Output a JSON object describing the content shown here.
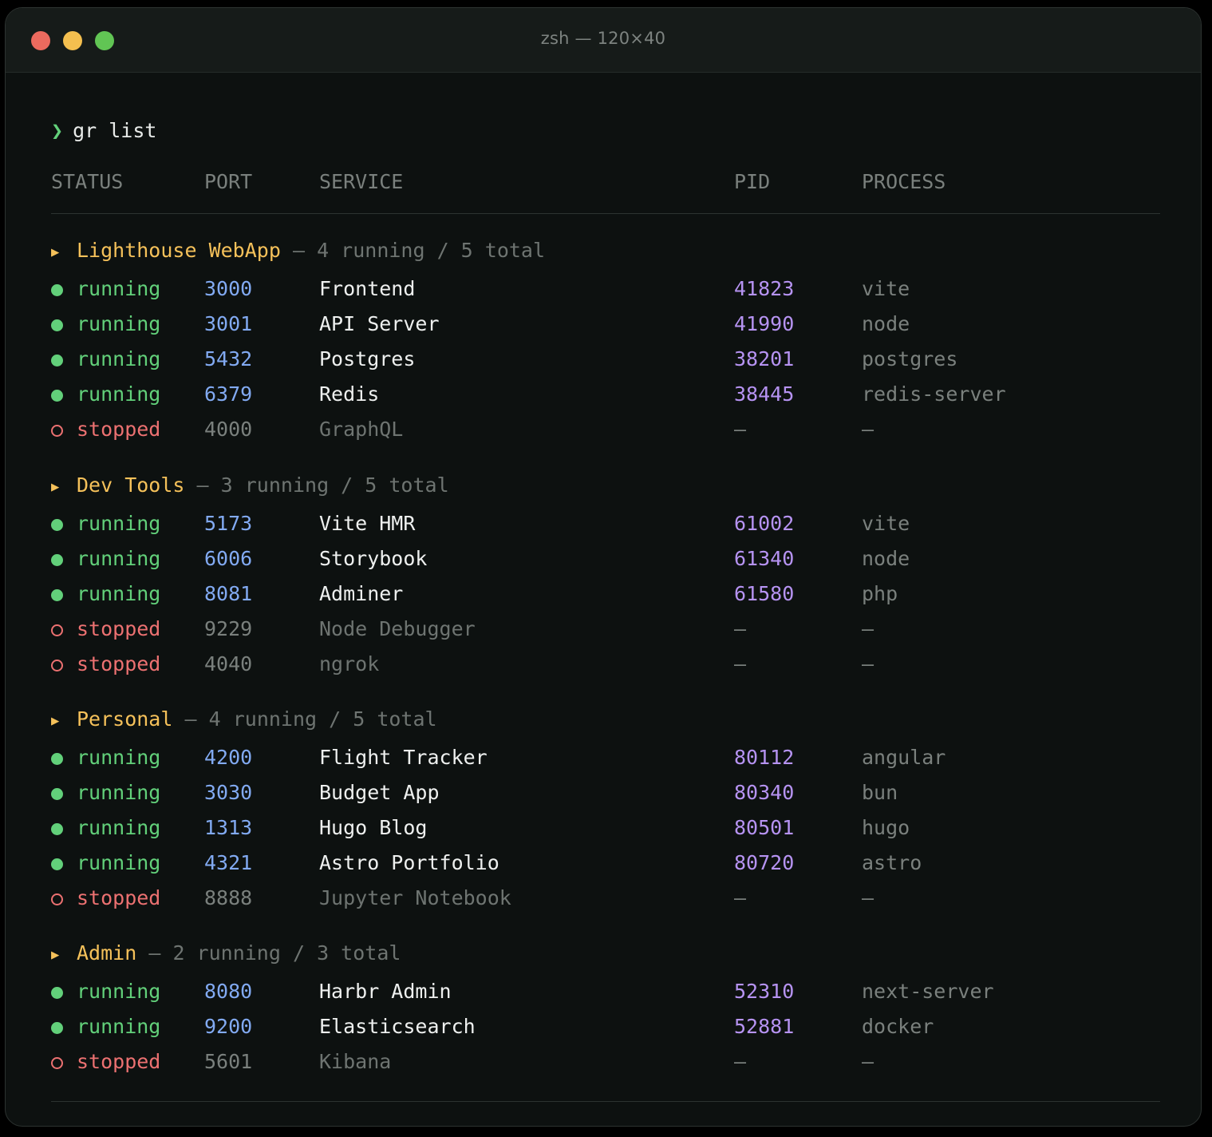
{
  "window": {
    "title": "zsh — 120×40"
  },
  "prompt": {
    "symbol": "❯",
    "command": "gr list"
  },
  "columns": {
    "status": "STATUS",
    "port": "PORT",
    "service": "SERVICE",
    "pid": "PID",
    "process": "PROCESS"
  },
  "groups": [
    {
      "name": "Lighthouse WebApp",
      "arrow": "▶",
      "separator": "—",
      "counts": "4 running / 5 total",
      "rows": [
        {
          "status": "running",
          "port": "3000",
          "service": "Frontend",
          "pid": "41823",
          "process": "vite"
        },
        {
          "status": "running",
          "port": "3001",
          "service": "API Server",
          "pid": "41990",
          "process": "node"
        },
        {
          "status": "running",
          "port": "5432",
          "service": "Postgres",
          "pid": "38201",
          "process": "postgres"
        },
        {
          "status": "running",
          "port": "6379",
          "service": "Redis",
          "pid": "38445",
          "process": "redis-server"
        },
        {
          "status": "stopped",
          "port": "4000",
          "service": "GraphQL",
          "pid": "—",
          "process": "—"
        }
      ]
    },
    {
      "name": "Dev Tools",
      "arrow": "▶",
      "separator": "—",
      "counts": "3 running / 5 total",
      "rows": [
        {
          "status": "running",
          "port": "5173",
          "service": "Vite HMR",
          "pid": "61002",
          "process": "vite"
        },
        {
          "status": "running",
          "port": "6006",
          "service": "Storybook",
          "pid": "61340",
          "process": "node"
        },
        {
          "status": "running",
          "port": "8081",
          "service": "Adminer",
          "pid": "61580",
          "process": "php"
        },
        {
          "status": "stopped",
          "port": "9229",
          "service": "Node Debugger",
          "pid": "—",
          "process": "—"
        },
        {
          "status": "stopped",
          "port": "4040",
          "service": "ngrok",
          "pid": "—",
          "process": "—"
        }
      ]
    },
    {
      "name": "Personal",
      "arrow": "▶",
      "separator": "—",
      "counts": "4 running / 5 total",
      "rows": [
        {
          "status": "running",
          "port": "4200",
          "service": "Flight Tracker",
          "pid": "80112",
          "process": "angular"
        },
        {
          "status": "running",
          "port": "3030",
          "service": "Budget App",
          "pid": "80340",
          "process": "bun"
        },
        {
          "status": "running",
          "port": "1313",
          "service": "Hugo Blog",
          "pid": "80501",
          "process": "hugo"
        },
        {
          "status": "running",
          "port": "4321",
          "service": "Astro Portfolio",
          "pid": "80720",
          "process": "astro"
        },
        {
          "status": "stopped",
          "port": "8888",
          "service": "Jupyter Notebook",
          "pid": "—",
          "process": "—"
        }
      ]
    },
    {
      "name": "Admin",
      "arrow": "▶",
      "separator": "—",
      "counts": "2 running / 3 total",
      "rows": [
        {
          "status": "running",
          "port": "8080",
          "service": "Harbr Admin",
          "pid": "52310",
          "process": "next-server"
        },
        {
          "status": "running",
          "port": "9200",
          "service": "Elasticsearch",
          "pid": "52881",
          "process": "docker"
        },
        {
          "status": "stopped",
          "port": "5601",
          "service": "Kibana",
          "pid": "—",
          "process": "—"
        }
      ]
    }
  ],
  "colors": {
    "running": "#62d07a",
    "stopped": "#ec7171",
    "port": "#82aaf2",
    "pid": "#b693f2",
    "group": "#f5c15a"
  }
}
